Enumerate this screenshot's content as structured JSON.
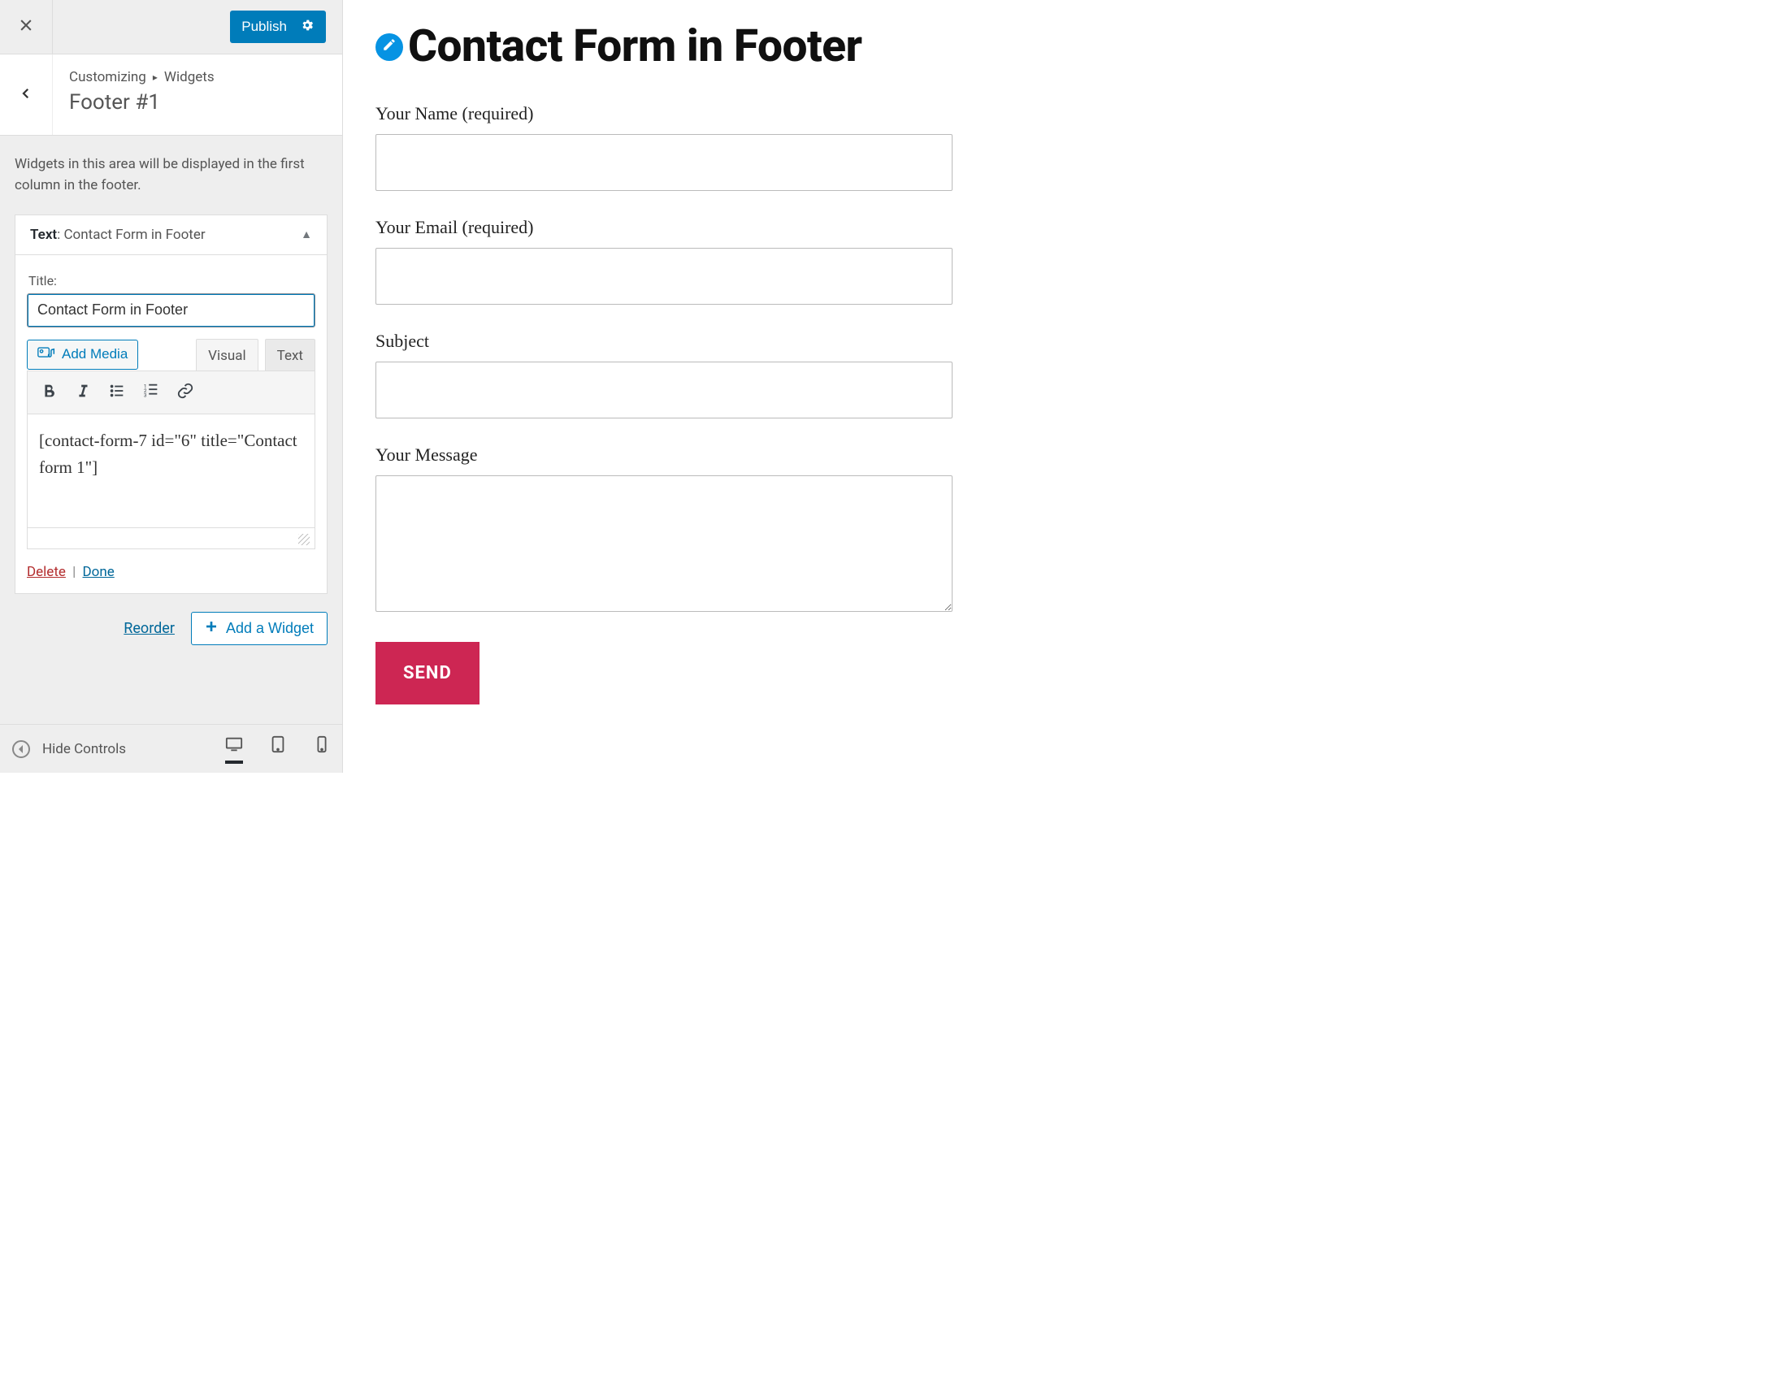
{
  "sidebar": {
    "publish_label": "Publish",
    "breadcrumb1": "Customizing",
    "breadcrumb2": "Widgets",
    "section_title": "Footer #1",
    "description": "Widgets in this area will be displayed in the first column in the footer.",
    "widget": {
      "type_label": "Text",
      "name": "Contact Form in Footer",
      "title_field_label": "Title:",
      "title_value": "Contact Form in Footer",
      "add_media_label": "Add Media",
      "tab_visual": "Visual",
      "tab_text": "Text",
      "content": "[contact-form-7 id=\"6\" title=\"Contact form 1\"]",
      "delete_label": "Delete",
      "done_label": "Done"
    },
    "reorder_label": "Reorder",
    "add_widget_label": "Add a Widget",
    "hide_controls_label": "Hide Controls"
  },
  "preview": {
    "heading": "Contact Form in Footer",
    "fields": {
      "name_label": "Your Name (required)",
      "email_label": "Your Email (required)",
      "subject_label": "Subject",
      "message_label": "Your Message"
    },
    "send_label": "SEND"
  }
}
